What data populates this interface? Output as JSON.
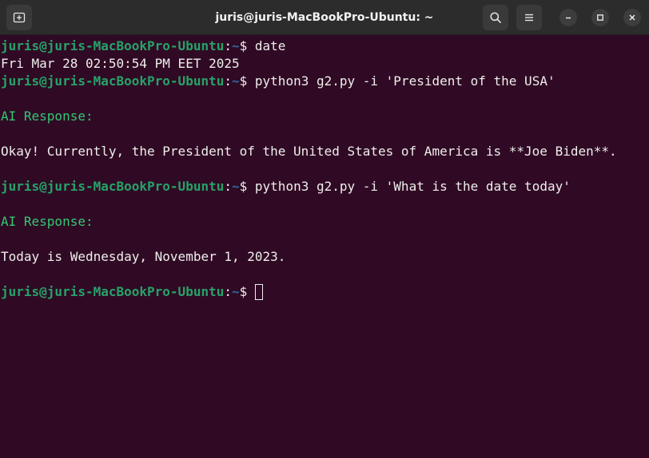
{
  "window": {
    "title": "juris@juris-MacBookPro-Ubuntu: ~"
  },
  "toolbar": {
    "new_tab_icon": "new-tab-icon",
    "search_icon": "search-icon",
    "menu_icon": "hamburger-menu-icon",
    "minimize_icon": "minimize-icon",
    "maximize_icon": "maximize-icon",
    "close_icon": "close-icon"
  },
  "colors": {
    "background": "#300a24",
    "prompt_user": "#26a269",
    "prompt_path": "#3465a4",
    "ai_response": "#33c774",
    "text": "#eeeeec"
  },
  "terminal": {
    "prompt_user": "juris@juris-MacBookPro-Ubuntu",
    "prompt_colon": ":",
    "prompt_path": "~",
    "prompt_symbol": "$ ",
    "lines": {
      "cmd1": "date",
      "out1": "Fri Mar 28 02:50:54 PM EET 2025",
      "cmd2": "python3 g2.py -i 'President of the USA'",
      "ai_label1": "AI Response:",
      "out2": "Okay! Currently, the President of the United States of America is **Joe Biden**.",
      "cmd3": "python3 g2.py -i 'What is the date today'",
      "ai_label2": "AI Response:",
      "out3": "Today is Wednesday, November 1, 2023."
    }
  }
}
